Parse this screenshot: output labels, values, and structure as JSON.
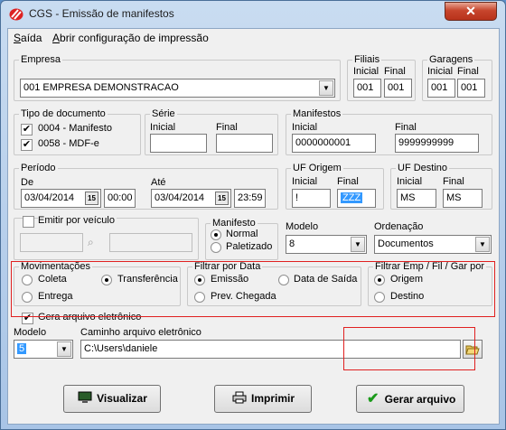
{
  "window": {
    "title": "CGS - Emissão de manifestos",
    "close": "✕"
  },
  "menu": {
    "items": [
      "Saída",
      "Abrir configuração de impressão"
    ]
  },
  "empresa": {
    "legend": "Empresa",
    "value": "001 EMPRESA DEMONSTRACAO"
  },
  "filiais": {
    "legend": "Filiais",
    "inicial_label": "Inicial",
    "final_label": "Final",
    "inicial": "001",
    "final": "001"
  },
  "garagens": {
    "legend": "Garagens",
    "inicial_label": "Inicial",
    "final_label": "Final",
    "inicial": "001",
    "final": "001"
  },
  "tipo_documento": {
    "legend": "Tipo de documento",
    "items": [
      {
        "label": "0004 - Manifesto",
        "checked": true
      },
      {
        "label": "0058 - MDF-e",
        "checked": true
      }
    ]
  },
  "serie": {
    "legend": "Série",
    "inicial_label": "Inicial",
    "final_label": "Final",
    "inicial": "",
    "final": ""
  },
  "manifestos": {
    "legend": "Manifestos",
    "inicial_label": "Inicial",
    "final_label": "Final",
    "inicial": "0000000001",
    "final": "9999999999"
  },
  "periodo": {
    "legend": "Período",
    "de_label": "De",
    "ate_label": "Até",
    "de_date": "03/04/2014",
    "de_time": "00:00",
    "ate_date": "03/04/2014",
    "ate_time": "23:59",
    "cal_icon": "15"
  },
  "uf_origem": {
    "legend": "UF Origem",
    "inicial_label": "Inicial",
    "final_label": "Final",
    "inicial": "!",
    "final": "ZZZ"
  },
  "uf_destino": {
    "legend": "UF Destino",
    "inicial_label": "Inicial",
    "final_label": "Final",
    "inicial": "MS",
    "final": "MS"
  },
  "emitir_veiculo": {
    "label": "Emitir por veículo",
    "checked": false
  },
  "manifesto_tipo": {
    "legend": "Manifesto",
    "options": [
      "Normal",
      "Paletizado"
    ],
    "selected": "Normal"
  },
  "modelo": {
    "label": "Modelo",
    "value": "8"
  },
  "ordenacao": {
    "label": "Ordenação",
    "value": "Documentos"
  },
  "movimentacoes": {
    "legend": "Movimentações",
    "options": [
      "Coleta",
      "Transferência",
      "Entrega"
    ],
    "selected": "Transferência"
  },
  "filtrar_data": {
    "legend": "Filtrar por Data",
    "options": [
      "Emissão",
      "Data de Saída",
      "Prev. Chegada"
    ],
    "selected": "Emissão"
  },
  "filtrar_emp": {
    "legend": "Filtrar Emp / Fil / Gar por",
    "options": [
      "Origem",
      "Destino"
    ],
    "selected": "Origem"
  },
  "gera_arquivo": {
    "label": "Gera arquivo eletrônico",
    "checked": true
  },
  "arquivo": {
    "modelo_label": "Modelo",
    "modelo_value": "5",
    "caminho_label": "Caminho arquivo eletrônico",
    "caminho_value": "C:\\Users\\daniele"
  },
  "buttons": {
    "visualizar": "Visualizar",
    "imprimir": "Imprimir",
    "gerar": "Gerar arquivo"
  },
  "colors": {
    "highlight_border": "#e02020",
    "selection": "#3399ff",
    "close_button": "#c7462d"
  }
}
